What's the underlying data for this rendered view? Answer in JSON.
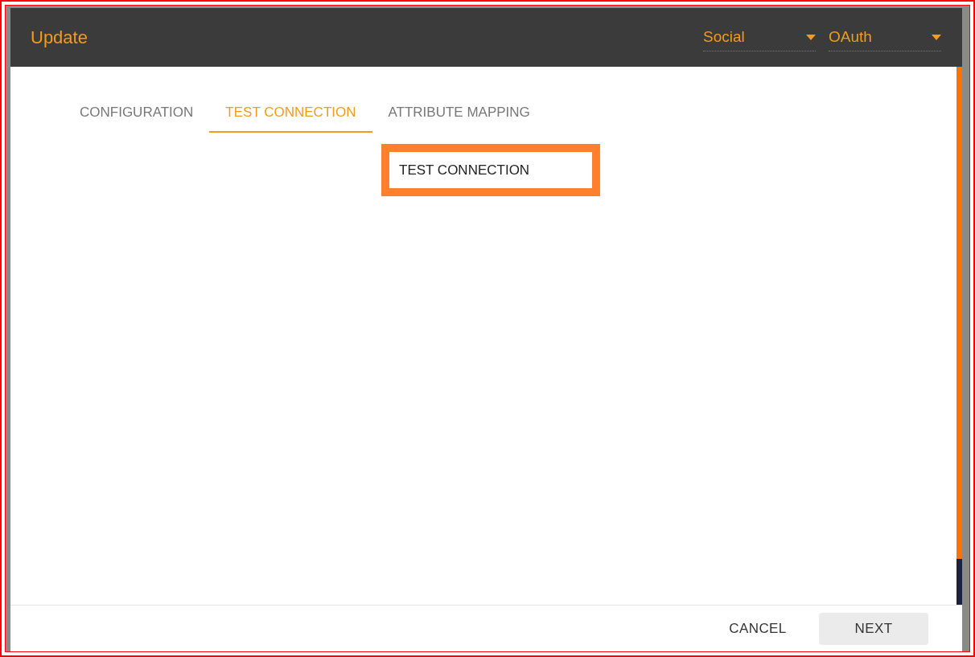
{
  "dialog": {
    "title": "Update"
  },
  "header_selects": [
    {
      "value": "Social"
    },
    {
      "value": "OAuth"
    }
  ],
  "tabs": [
    {
      "label": "CONFIGURATION",
      "selected": false
    },
    {
      "label": "TEST CONNECTION",
      "selected": true
    },
    {
      "label": "ATTRIBUTE MAPPING",
      "selected": false
    }
  ],
  "test_button": {
    "label": "TEST CONNECTION",
    "highlighted": true
  },
  "footer_buttons": [
    {
      "label": "CANCEL",
      "kind": "text"
    },
    {
      "label": "NEXT",
      "kind": "filled"
    }
  ]
}
